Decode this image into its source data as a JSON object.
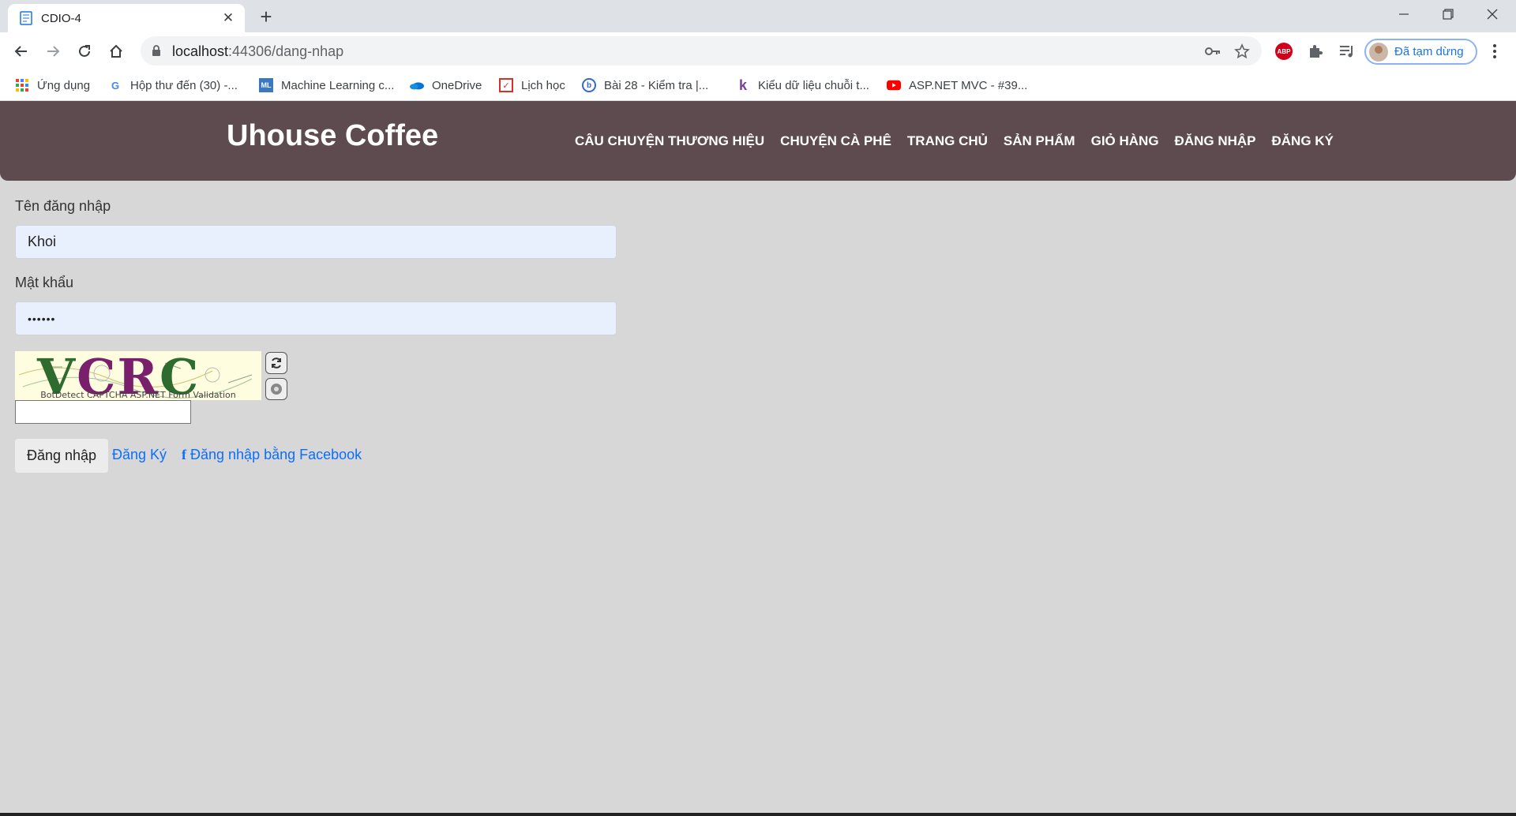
{
  "browser": {
    "tab_title": "CDIO-4",
    "url_host": "localhost",
    "url_path": ":44306/dang-nhap",
    "profile_label": "Đã tạm dừng"
  },
  "bookmarks": [
    {
      "label": "Ứng dụng",
      "icon": "apps-grid-icon"
    },
    {
      "label": "Hộp thư đến (30) -...",
      "icon": "google-icon"
    },
    {
      "label": "Machine Learning c...",
      "icon": "ml-icon"
    },
    {
      "label": "OneDrive",
      "icon": "onedrive-icon"
    },
    {
      "label": "Lịch học",
      "icon": "calendar-icon"
    },
    {
      "label": "Bài 28 - Kiểm tra |...",
      "icon": "site-icon"
    },
    {
      "label": "Kiểu dữ liệu chuỗi t...",
      "icon": "k-icon"
    },
    {
      "label": "ASP.NET MVC - #39...",
      "icon": "youtube-icon"
    }
  ],
  "site": {
    "brand": "Uhouse Coffee",
    "nav": [
      "CÂU CHUYỆN THƯƠNG HIỆU",
      "CHUYỆN CÀ PHÊ",
      "TRANG CHỦ",
      "SẢN PHẨM",
      "GIỎ HÀNG",
      "ĐĂNG NHẬP",
      "ĐĂNG KÝ"
    ]
  },
  "form": {
    "username_label": "Tên đăng nhập",
    "username_value": "Khoi",
    "password_label": "Mật khẩu",
    "password_value": "••••••",
    "captcha_text": "VCRC",
    "captcha_caption": "BotDetect CAPTCHA ASP.NET Form Validation",
    "captcha_input_value": "",
    "login_button": "Đăng nhập",
    "register_link": "Đăng Ký",
    "facebook_link": "Đăng nhập bằng Facebook"
  },
  "colors": {
    "header_bg": "#5e4b4f",
    "page_bg": "#d7d7d7",
    "link": "#0d6efd",
    "input_autofill": "#e8f0fe"
  }
}
